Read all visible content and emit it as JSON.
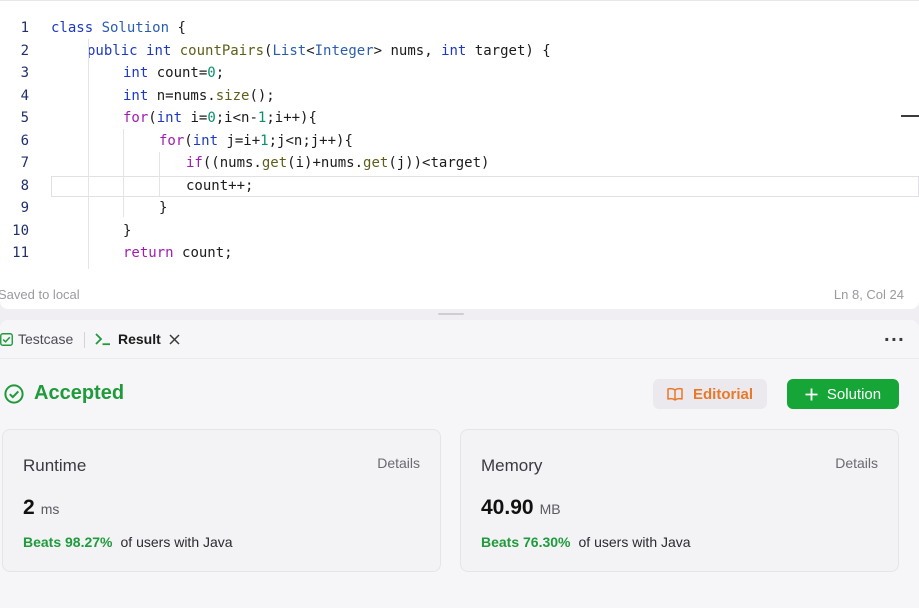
{
  "editor": {
    "lines": [
      {
        "n": "1",
        "indent": 0,
        "tokens": [
          {
            "t": "class ",
            "c": "kw"
          },
          {
            "t": "Solution",
            "c": "ty"
          },
          {
            "t": " {",
            "c": ""
          }
        ]
      },
      {
        "n": "2",
        "indent": 1,
        "tokens": [
          {
            "t": "public ",
            "c": "kw"
          },
          {
            "t": "int ",
            "c": "kw"
          },
          {
            "t": "countPairs",
            "c": "fn"
          },
          {
            "t": "(",
            "c": ""
          },
          {
            "t": "List",
            "c": "ty"
          },
          {
            "t": "<",
            "c": ""
          },
          {
            "t": "Integer",
            "c": "ty"
          },
          {
            "t": "> nums, ",
            "c": ""
          },
          {
            "t": "int ",
            "c": "kw"
          },
          {
            "t": "target) {",
            "c": ""
          }
        ]
      },
      {
        "n": "3",
        "indent": 2,
        "tokens": [
          {
            "t": "int ",
            "c": "kw"
          },
          {
            "t": "count=",
            "c": ""
          },
          {
            "t": "0",
            "c": "num"
          },
          {
            "t": ";",
            "c": ""
          }
        ]
      },
      {
        "n": "4",
        "indent": 2,
        "tokens": [
          {
            "t": "int ",
            "c": "kw"
          },
          {
            "t": "n=nums.",
            "c": ""
          },
          {
            "t": "size",
            "c": "fn"
          },
          {
            "t": "();",
            "c": ""
          }
        ]
      },
      {
        "n": "5",
        "indent": 2,
        "tokens": [
          {
            "t": "for",
            "c": "ctrl"
          },
          {
            "t": "(",
            "c": ""
          },
          {
            "t": "int ",
            "c": "kw"
          },
          {
            "t": "i=",
            "c": ""
          },
          {
            "t": "0",
            "c": "num"
          },
          {
            "t": ";i<n-",
            "c": ""
          },
          {
            "t": "1",
            "c": "num"
          },
          {
            "t": ";i++){",
            "c": ""
          }
        ]
      },
      {
        "n": "6",
        "indent": 3,
        "tokens": [
          {
            "t": "for",
            "c": "ctrl"
          },
          {
            "t": "(",
            "c": ""
          },
          {
            "t": "int ",
            "c": "kw"
          },
          {
            "t": "j=i+",
            "c": ""
          },
          {
            "t": "1",
            "c": "num"
          },
          {
            "t": ";j<n;j++){",
            "c": ""
          }
        ]
      },
      {
        "n": "7",
        "indent": 3.75,
        "tokens": [
          {
            "t": "if",
            "c": "ctrl"
          },
          {
            "t": "((nums.",
            "c": ""
          },
          {
            "t": "get",
            "c": "fn"
          },
          {
            "t": "(i)+nums.",
            "c": ""
          },
          {
            "t": "get",
            "c": "fn"
          },
          {
            "t": "(j))<target)",
            "c": ""
          }
        ]
      },
      {
        "n": "8",
        "indent": 3.75,
        "tokens": [
          {
            "t": "count++;",
            "c": ""
          }
        ],
        "current": true
      },
      {
        "n": "9",
        "indent": 3,
        "tokens": [
          {
            "t": "}",
            "c": ""
          }
        ]
      },
      {
        "n": "10",
        "indent": 2,
        "tokens": [
          {
            "t": "}",
            "c": ""
          }
        ]
      },
      {
        "n": "11",
        "indent": 2,
        "tokens": [
          {
            "t": "return ",
            "c": "ctrl"
          },
          {
            "t": "count;",
            "c": ""
          }
        ]
      }
    ],
    "status_left": "Saved to local",
    "status_right": "Ln 8, Col 24"
  },
  "tabs": {
    "testcase_label": "Testcase",
    "result_label": "Result"
  },
  "result": {
    "status": "Accepted",
    "editorial_label": "Editorial",
    "solution_label": "Solution"
  },
  "runtime": {
    "title": "Runtime",
    "details": "Details",
    "value": "2",
    "unit": "ms",
    "beats": "Beats 98.27%",
    "suffix": "of users with Java"
  },
  "memory": {
    "title": "Memory",
    "details": "Details",
    "value": "40.90",
    "unit": "MB",
    "beats": "Beats 76.30%",
    "suffix": "of users with Java"
  },
  "colors": {
    "accepted": "#1f9b3c",
    "editorial": "#e9792a",
    "solution_bg": "#16a637"
  },
  "icons": {
    "testcase": "check-square-icon",
    "result": "terminal-icon",
    "close": "close-icon",
    "more": "more-horizontal-icon",
    "accepted": "check-circle-icon",
    "editorial": "book-icon",
    "solution": "plus-icon"
  }
}
